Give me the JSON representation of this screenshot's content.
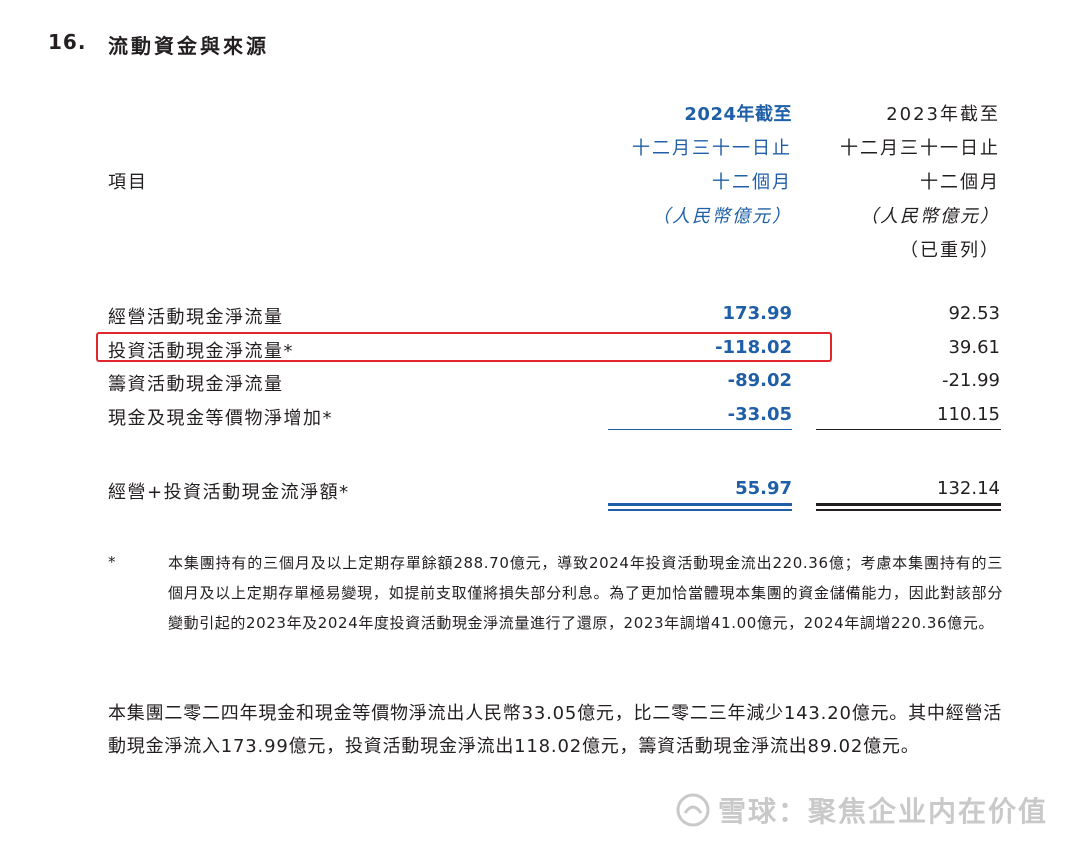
{
  "section": {
    "number": "16.",
    "title": "流動資金與來源"
  },
  "header": {
    "item_label": "項目",
    "col2024": {
      "line1": "2024年截至",
      "line2": "十二月三十一日止",
      "line3": "十二個月",
      "line4": "（人民幣億元）"
    },
    "col2023": {
      "line1": "2023年截至",
      "line2": "十二月三十一日止",
      "line3": "十二個月",
      "line4": "（人民幣億元）",
      "line5": "（已重列）"
    }
  },
  "rows": [
    {
      "label": "經營活動現金淨流量",
      "v2024": "173.99",
      "v2023": "92.53"
    },
    {
      "label": "投資活動現金淨流量*",
      "v2024": "-118.02",
      "v2023": "39.61"
    },
    {
      "label": "籌資活動現金淨流量",
      "v2024": "-89.02",
      "v2023": "-21.99"
    },
    {
      "label": "現金及現金等價物淨增加*",
      "v2024": "-33.05",
      "v2023": "110.15"
    }
  ],
  "total": {
    "label": "經營+投資活動現金流淨額*",
    "v2024": "55.97",
    "v2023": "132.14"
  },
  "footnote": {
    "marker": "*",
    "text": "本集團持有的三個月及以上定期存單餘額288.70億元，導致2024年投資活動現金流出220.36億；考慮本集團持有的三個月及以上定期存單極易變現，如提前支取僅將損失部分利息。為了更加恰當體現本集團的資金儲備能力，因此對該部分變動引起的2023年及2024年度投資活動現金淨流量進行了還原，2023年調增41.00億元，2024年調增220.36億元。"
  },
  "paragraph": "本集團二零二四年現金和現金等價物淨流出人民幣33.05億元，比二零二三年減少143.20億元。其中經營活動現金淨流入173.99億元，投資活動現金淨流出118.02億元，籌資活動現金淨流出89.02億元。",
  "watermark": "雪球：聚焦企业内在价值",
  "colors": {
    "accent_blue": "#1f5fa8",
    "highlight_red": "#e3262b",
    "text": "#231f20"
  }
}
